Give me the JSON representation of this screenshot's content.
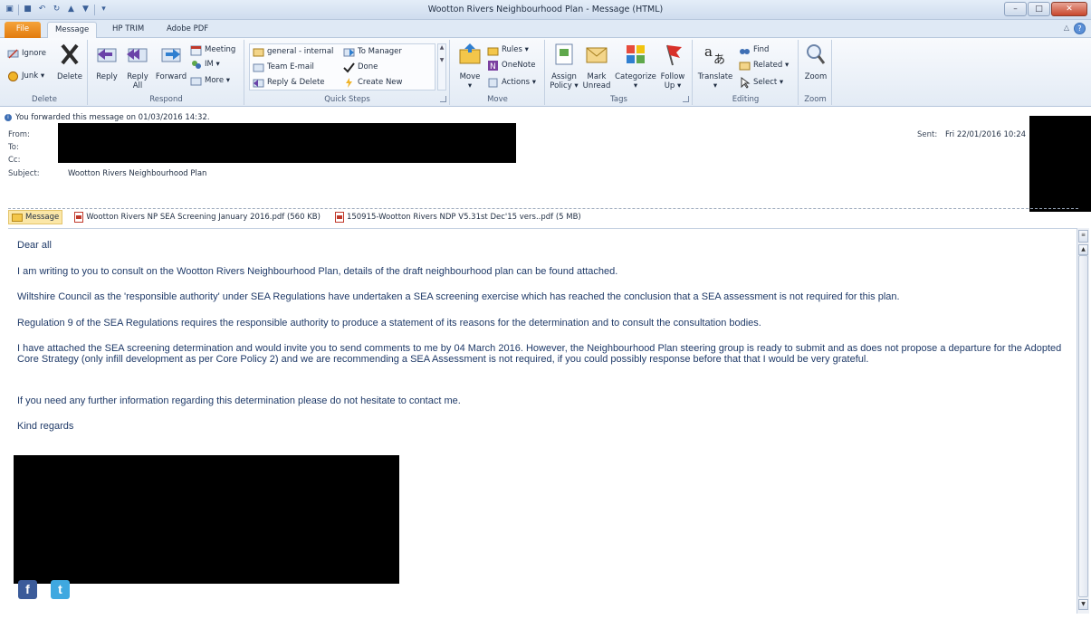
{
  "window": {
    "title": "Wootton Rivers Neighbourhood Plan - Message (HTML)",
    "controls": {
      "minimize": "–",
      "maximize": "□",
      "close": "✕"
    }
  },
  "tabs": [
    "File",
    "Message",
    "HP TRIM",
    "Adobe PDF"
  ],
  "ribbon": {
    "delete": {
      "label": "Delete",
      "ignore": "Ignore",
      "junk": "Junk ▾",
      "delete_btn": "Delete"
    },
    "respond": {
      "label": "Respond",
      "reply": "Reply",
      "reply_all_1": "Reply",
      "reply_all_2": "All",
      "forward": "Forward",
      "meeting": "Meeting",
      "im": "IM ▾",
      "more": "More ▾"
    },
    "quick_steps": {
      "label": "Quick Steps",
      "items": [
        "general - internal",
        "Team E-mail",
        "Reply & Delete",
        "To Manager",
        "Done",
        "Create New"
      ]
    },
    "move": {
      "label": "Move",
      "move_1": "Move",
      "move_2": "▾",
      "rules": "Rules ▾",
      "onenote": "OneNote",
      "actions": "Actions ▾"
    },
    "tags": {
      "label": "Tags",
      "assign_1": "Assign",
      "assign_2": "Policy ▾",
      "mark_1": "Mark",
      "mark_2": "Unread",
      "categorize_1": "Categorize",
      "categorize_2": "▾",
      "follow_1": "Follow",
      "follow_2": "Up ▾"
    },
    "editing": {
      "label": "Editing",
      "translate_1": "Translate",
      "translate_2": "▾",
      "find": "Find",
      "related": "Related ▾",
      "select": "Select ▾"
    },
    "zoom": {
      "label": "Zoom",
      "zoom_btn": "Zoom"
    }
  },
  "header": {
    "info": "You forwarded this message on 01/03/2016 14:32.",
    "from_label": "From:",
    "to_label": "To:",
    "cc_label": "Cc:",
    "subject_label": "Subject:",
    "subject": "Wootton Rivers Neighbourhood Plan",
    "sent_label": "Sent:",
    "sent": "Fri 22/01/2016 10:24"
  },
  "attachments": {
    "message": "Message",
    "files": [
      "Wootton Rivers NP SEA Screening January 2016.pdf (560 KB)",
      "150915-Wootton Rivers NDP V5.31st Dec'15 vers..pdf (5 MB)"
    ]
  },
  "body": {
    "paragraphs": [
      "Dear all",
      "I am writing to you to consult on the Wootton Rivers Neighbourhood Plan, details of the draft neighbourhood plan can be found attached.",
      "Wiltshire Council as the 'responsible authority' under SEA Regulations have undertaken a SEA screening exercise which has reached the conclusion that a SEA assessment is not required for this plan.",
      "Regulation 9 of the SEA Regulations requires the responsible authority to produce a statement of its reasons for the determination and to consult the consultation bodies.",
      "I have attached the SEA screening determination and would invite you to send comments to me by 04 March 2016. However, the Neighbourhood Plan steering group is ready to submit and as does not propose a departure for the Adopted Core Strategy (only infill development as per Core Policy 2) and we are recommending a SEA Assessment is not required, if you could possibly response before that that I would be very grateful.",
      "If you need any further information regarding this determination please do not hesitate to contact me.",
      "Kind regards"
    ],
    "social": {
      "facebook": "f",
      "twitter": "t"
    }
  },
  "colors": {
    "file_tab": "#e27b0e",
    "body_text": "#1f3a68",
    "accent": "#3e6fb5"
  }
}
